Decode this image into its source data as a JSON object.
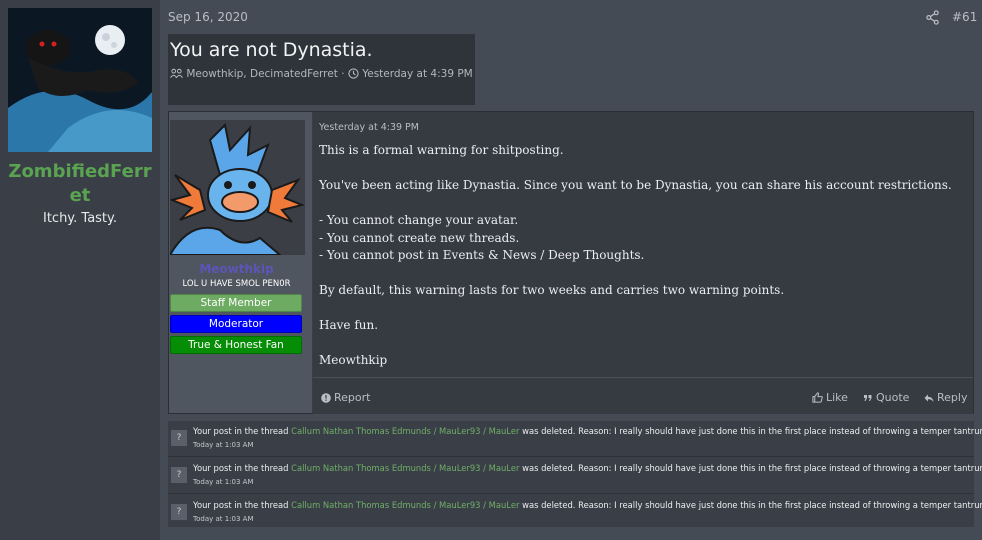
{
  "profile": {
    "username": "ZombifiedFerret",
    "username_line1": "ZombifiedFerr",
    "username_line2": "et",
    "user_title": "Itchy. Tasty."
  },
  "post": {
    "date": "Sep 16, 2020",
    "number": "#61",
    "share_icon": "share-icon"
  },
  "thread": {
    "title": "You are not Dynastia.",
    "participants": "Meowthkip, DecimatedFerret",
    "separator": "·",
    "time": "Yesterday at 4:39 PM"
  },
  "message": {
    "author": "Meowthkip",
    "author_title": "LOL U HAVE SMOL PEN0R",
    "banners": [
      "Staff Member",
      "Moderator",
      "True & Honest Fan"
    ],
    "time": "Yesterday at 4:39 PM",
    "paragraphs": {
      "p1": "This is a formal warning for shitposting.",
      "p2": "You've been acting like Dynastia. Since you want to be Dynastia, you can share his account restrictions.",
      "p3a": "- You cannot change your avatar.",
      "p3b": "- You cannot create new threads.",
      "p3c": "- You cannot post in Events & News / Deep Thoughts.",
      "p4": "By default, this warning lasts for two weeks and carries two warning points.",
      "p5": "Have fun.",
      "p6": "Meowthkip"
    },
    "footer": {
      "report": "Report",
      "like": "Like",
      "quote": "Quote",
      "reply": "Reply"
    }
  },
  "alerts": [
    {
      "icon": "?",
      "prefix": "Your post in the thread",
      "link": "Callum Nathan Thomas Edmunds / MauLer93 / MauLer",
      "suffix": "was deleted. Reason: I really should have just done this in the first place instead of throwing a temper tantrum. My bad.",
      "time": "Today at 1:03 AM"
    },
    {
      "icon": "?",
      "prefix": "Your post in the thread",
      "link": "Callum Nathan Thomas Edmunds / MauLer93 / MauLer",
      "suffix": "was deleted. Reason: I really should have just done this in the first place instead of throwing a temper tantrum. My bad.",
      "time": "Today at 1:03 AM"
    },
    {
      "icon": "?",
      "prefix": "Your post in the thread",
      "link": "Callum Nathan Thomas Edmunds / MauLer93 / MauLer",
      "suffix": "was deleted. Reason: I really should have just done this in the first place instead of throwing a temper tantrum. My bad.",
      "time": "Today at 1:03 AM"
    }
  ],
  "colors": {
    "username_green": "#5aa351",
    "staff_banner": "#6cab61",
    "moderator_banner": "#0000ff",
    "fan_banner": "#068d06",
    "alert_link": "#6fae66"
  }
}
